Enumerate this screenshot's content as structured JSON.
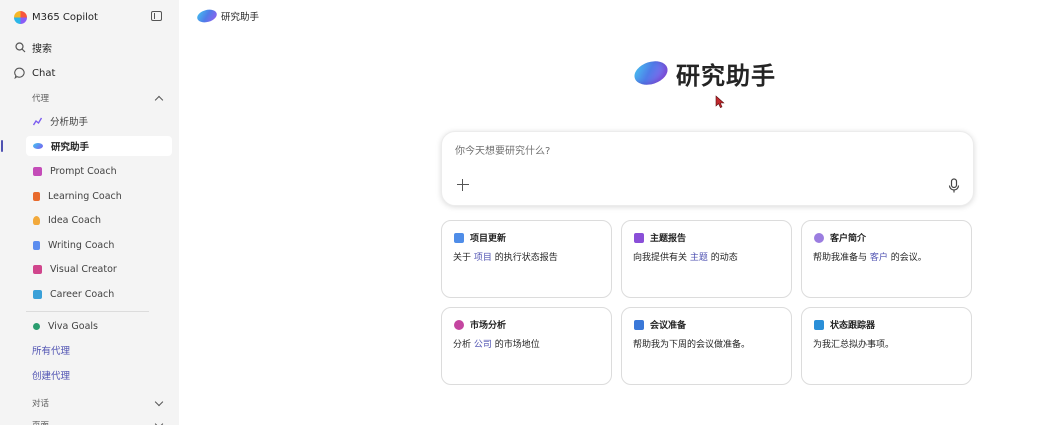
{
  "sidebar": {
    "app_title": "M365 Copilot",
    "search_label": "搜索",
    "chat_label": "Chat",
    "agents_section": "代理",
    "agents": [
      {
        "label": "分析助手",
        "color": "#7b5cf0"
      },
      {
        "label": "研究助手",
        "color": "#4f7ce8",
        "active": true
      },
      {
        "label": "Prompt Coach",
        "color": "#c44cb8"
      },
      {
        "label": "Learning Coach",
        "color": "#e86a2c"
      },
      {
        "label": "Idea Coach",
        "color": "#f2a93b"
      },
      {
        "label": "Writing Coach",
        "color": "#5b8def"
      },
      {
        "label": "Visual Creator",
        "color": "#d0458c"
      },
      {
        "label": "Career Coach",
        "color": "#3aa0d8"
      },
      {
        "label": "Viva Goals",
        "color": "#2a9d6f"
      }
    ],
    "all_agents_link": "所有代理",
    "create_agent_link": "创建代理",
    "conversations_section": "对话",
    "cut_off_section": "页面"
  },
  "top_bar": {
    "agent_name": "研究助手"
  },
  "hero": {
    "title": "研究助手"
  },
  "prompt": {
    "placeholder": "你今天想要研究什么?"
  },
  "cards": [
    {
      "title": "项目更新",
      "pre": "关于 ",
      "hl": "项目",
      "post": " 的执行状态报告",
      "color": "#4f8de8"
    },
    {
      "title": "主题报告",
      "pre": "向我提供有关 ",
      "hl": "主题",
      "post": " 的动态",
      "color": "#8a4fd8"
    },
    {
      "title": "客户简介",
      "pre": "帮助我准备与 ",
      "hl": "客户",
      "post": " 的会议。",
      "color": "#9b7de0"
    },
    {
      "title": "市场分析",
      "pre": "分析 ",
      "hl": "公司",
      "post": " 的市场地位",
      "color": "#c445a0"
    },
    {
      "title": "会议准备",
      "pre": "",
      "hl": "",
      "post": "帮助我为下周的会议做准备。",
      "color": "#3a78d8"
    },
    {
      "title": "状态跟踪器",
      "pre": "",
      "hl": "",
      "post": "为我汇总拟办事项。",
      "color": "#2a8fd8"
    }
  ]
}
